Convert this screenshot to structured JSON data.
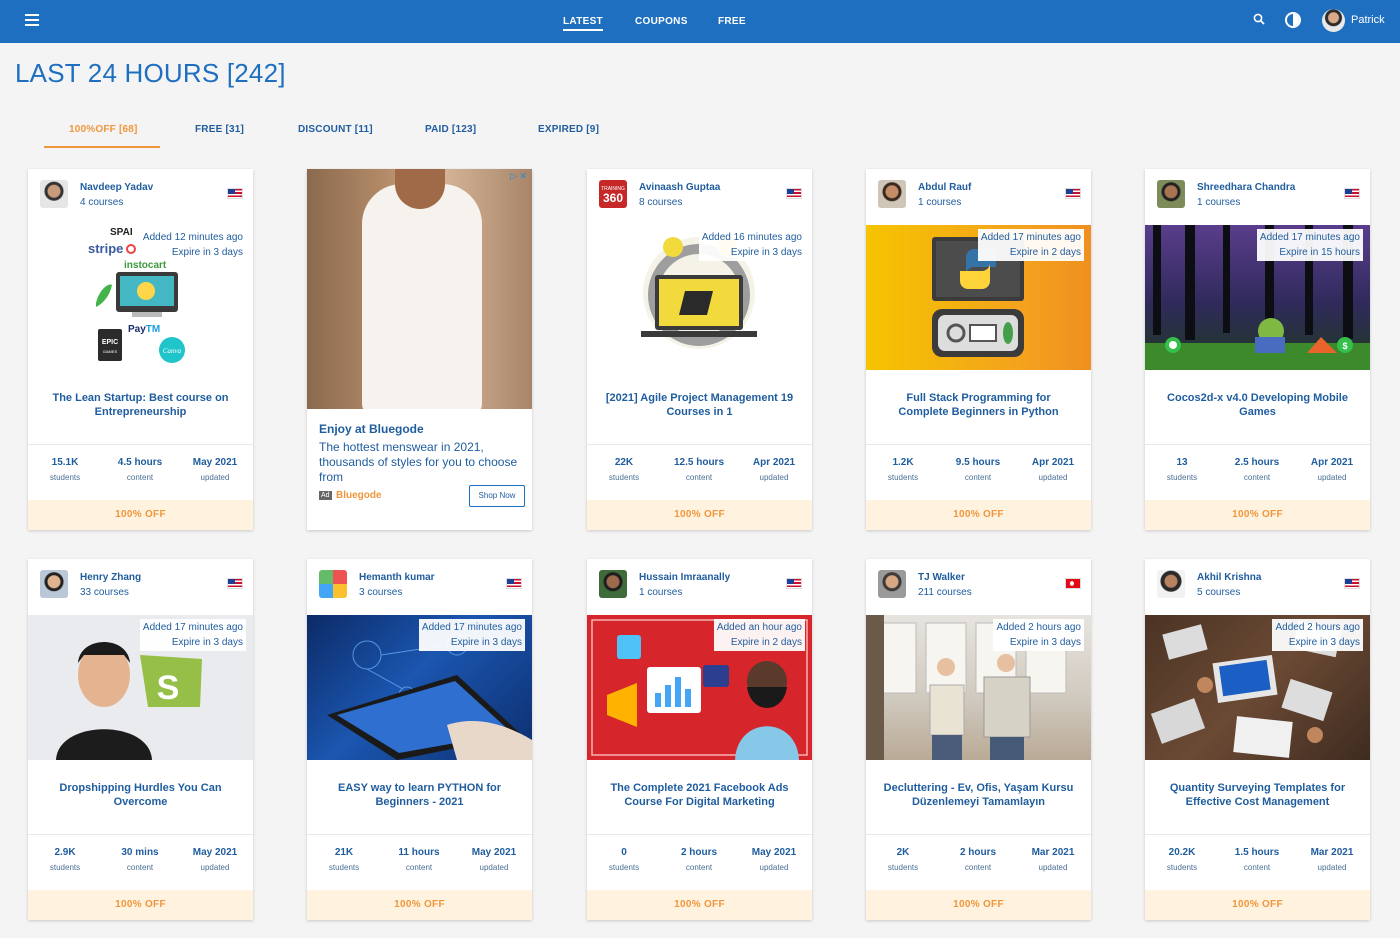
{
  "topbar": {
    "nav": [
      "LATEST",
      "COUPONS",
      "FREE"
    ],
    "user": "Patrick"
  },
  "page_title": "LAST 24 HOURS [242]",
  "tabs": [
    "100%OFF [68]",
    "FREE [31]",
    "DISCOUNT [11]",
    "PAID [123]",
    "EXPIRED [9]"
  ],
  "stat_labels": {
    "students": "students",
    "content": "content",
    "updated": "updated"
  },
  "off_label": "100% OFF",
  "ad": {
    "title": "Enjoy at Bluegode",
    "description": "The hottest menswear in 2021, thousands of styles for you to choose from",
    "tag": "Ad",
    "brand": "Bluegode",
    "button": "Shop Now",
    "choice": "▷ ✕"
  },
  "cards": [
    {
      "author": "Navdeep Yadav",
      "courses": "4 courses",
      "added": "Added 12 minutes ago",
      "expire": "Expire in 3 days",
      "title": "The Lean Startup: Best course on Entrepreneurship",
      "students": "15.1K",
      "content": "4.5 hours",
      "updated": "May 2021",
      "flag": "us"
    },
    {
      "author": "Avinaash Guptaa",
      "courses": "8 courses",
      "added": "Added 16 minutes ago",
      "expire": "Expire in 3 days",
      "title": "[2021] Agile Project Management 19 Courses in 1",
      "students": "22K",
      "content": "12.5 hours",
      "updated": "Apr 2021",
      "flag": "us"
    },
    {
      "author": "Abdul Rauf",
      "courses": "1 courses",
      "added": "Added 17 minutes ago",
      "expire": "Expire in 2 days",
      "title": "Full Stack Programming for Complete Beginners in Python",
      "students": "1.2K",
      "content": "9.5 hours",
      "updated": "Apr 2021",
      "flag": "us"
    },
    {
      "author": "Shreedhara Chandra",
      "courses": "1 courses",
      "added": "Added 17 minutes ago",
      "expire": "Expire in 15 hours",
      "title": "Cocos2d-x v4.0 Developing Mobile Games",
      "students": "13",
      "content": "2.5 hours",
      "updated": "Apr 2021",
      "flag": "us"
    },
    {
      "author": "Henry Zhang",
      "courses": "33 courses",
      "added": "Added 17 minutes ago",
      "expire": "Expire in 3 days",
      "title": "Dropshipping Hurdles You Can Overcome",
      "students": "2.9K",
      "content": "30 mins",
      "updated": "May 2021",
      "flag": "us"
    },
    {
      "author": "Hemanth kumar",
      "courses": "3 courses",
      "added": "Added 17 minutes ago",
      "expire": "Expire in 3 days",
      "title": "EASY way to learn PYTHON for Beginners - 2021",
      "students": "21K",
      "content": "11 hours",
      "updated": "May 2021",
      "flag": "us"
    },
    {
      "author": "Hussain Imraanally",
      "courses": "1 courses",
      "added": "Added an hour ago",
      "expire": "Expire in 2 days",
      "title": "The Complete 2021 Facebook Ads Course For Digital Marketing",
      "students": "0",
      "content": "2 hours",
      "updated": "May 2021",
      "flag": "us"
    },
    {
      "author": "TJ Walker",
      "courses": "211 courses",
      "added": "Added 2 hours ago",
      "expire": "Expire in 3 days",
      "title": "Decluttering - Ev, Ofis, Yaşam Kursu Düzenlemeyi Tamamlayın",
      "students": "2K",
      "content": "2 hours",
      "updated": "Mar 2021",
      "flag": "tr"
    },
    {
      "author": "Akhil Krishna",
      "courses": "5 courses",
      "added": "Added 2 hours ago",
      "expire": "Expire in 3 days",
      "title": "Quantity Surveying Templates for Effective Cost Management",
      "students": "20.2K",
      "content": "1.5 hours",
      "updated": "Mar 2021",
      "flag": "us"
    }
  ],
  "image_labels": {
    "card0": [
      "SPAI",
      "stripe",
      "instocart",
      "EPIC GAMES",
      "PayTM",
      "Canva"
    ],
    "card1_logo": "TRAINING 360"
  }
}
